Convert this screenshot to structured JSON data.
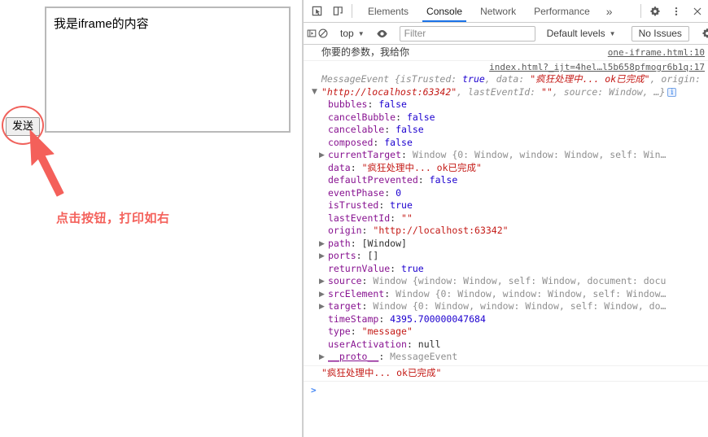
{
  "page": {
    "iframe_text": "我是iframe的内容",
    "send_button_label": "发送",
    "annotation": "点击按钮，打印如右"
  },
  "devtools": {
    "tabs": [
      {
        "label": "Elements",
        "active": false
      },
      {
        "label": "Console",
        "active": true
      },
      {
        "label": "Network",
        "active": false
      },
      {
        "label": "Performance",
        "active": false
      }
    ],
    "more_tabs_label": "»",
    "icons": {
      "inspect": "inspect-element-icon",
      "device": "device-toolbar-icon",
      "settings": "gear-icon",
      "kebab": "more-options-icon",
      "close": "close-icon",
      "sidebar": "console-sidebar-icon",
      "clear": "clear-console-icon",
      "eye": "live-expression-eye-icon",
      "filter_settings": "console-settings-gear-icon"
    },
    "filterbar": {
      "context_label": "top",
      "filter_placeholder": "Filter",
      "filter_value": "",
      "levels_label": "Default levels",
      "issues_label": "No Issues"
    },
    "accent_color": "#1a73e8"
  },
  "console": {
    "entry1": {
      "text": "你要的参数，我给你",
      "link": "one-iframe.html:10"
    },
    "entry2": {
      "link": "index.html?_ijt=4hel…l5b658pfmogr6b1q:17",
      "preview_line1_a": "MessageEvent {isTrusted: ",
      "preview_line1_b": "true",
      "preview_line1_c": ", data: ",
      "preview_line1_d": "\"疯狂处理中... ok已完成\"",
      "preview_line1_e": ", o",
      "preview_line2_a": "rigin: ",
      "preview_line2_b": "\"http://localhost:63342\"",
      "preview_line2_c": ", lastEventId: ",
      "preview_line2_d": "\"\"",
      "preview_line2_e": ", source: Win",
      "preview_line3": "dow, …}",
      "info_badge": "i",
      "properties": [
        {
          "expandable": false,
          "name": "bubbles",
          "value": "false",
          "kind": "bool"
        },
        {
          "expandable": false,
          "name": "cancelBubble",
          "value": "false",
          "kind": "bool"
        },
        {
          "expandable": false,
          "name": "cancelable",
          "value": "false",
          "kind": "bool"
        },
        {
          "expandable": false,
          "name": "composed",
          "value": "false",
          "kind": "bool"
        },
        {
          "expandable": true,
          "name": "currentTarget",
          "value": "Window {0: Window, window: Window, self: Win…",
          "kind": "obj"
        },
        {
          "expandable": false,
          "name": "data",
          "value": "\"疯狂处理中... ok已完成\"",
          "kind": "str"
        },
        {
          "expandable": false,
          "name": "defaultPrevented",
          "value": "false",
          "kind": "bool"
        },
        {
          "expandable": false,
          "name": "eventPhase",
          "value": "0",
          "kind": "num"
        },
        {
          "expandable": false,
          "name": "isTrusted",
          "value": "true",
          "kind": "bool"
        },
        {
          "expandable": false,
          "name": "lastEventId",
          "value": "\"\"",
          "kind": "str"
        },
        {
          "expandable": false,
          "name": "origin",
          "value": "\"http://localhost:63342\"",
          "kind": "str"
        },
        {
          "expandable": true,
          "name": "path",
          "value": "[Window]",
          "kind": "nul"
        },
        {
          "expandable": true,
          "name": "ports",
          "value": "[]",
          "kind": "nul"
        },
        {
          "expandable": false,
          "name": "returnValue",
          "value": "true",
          "kind": "bool"
        },
        {
          "expandable": true,
          "name": "source",
          "value": "Window {window: Window, self: Window, document: docu",
          "kind": "obj"
        },
        {
          "expandable": true,
          "name": "srcElement",
          "value": "Window {0: Window, window: Window, self: Window…",
          "kind": "obj"
        },
        {
          "expandable": true,
          "name": "target",
          "value": "Window {0: Window, window: Window, self: Window, do…",
          "kind": "obj"
        },
        {
          "expandable": false,
          "name": "timeStamp",
          "value": "4395.700000047684",
          "kind": "num"
        },
        {
          "expandable": false,
          "name": "type",
          "value": "\"message\"",
          "kind": "str"
        },
        {
          "expandable": false,
          "name": "userActivation",
          "value": "null",
          "kind": "nul"
        },
        {
          "expandable": true,
          "name": "__proto__",
          "value": "MessageEvent",
          "kind": "obj",
          "proto": true
        }
      ]
    },
    "entry3": {
      "text": "\"疯狂处理中... ok已完成\""
    },
    "prompt": ">"
  }
}
